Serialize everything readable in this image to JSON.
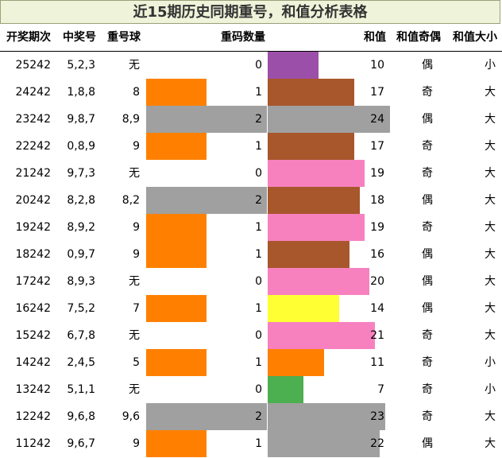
{
  "title": "近15期历史同期重号，和值分析表格",
  "headers": {
    "issue": "开奖期次",
    "number": "中奖号",
    "repeat_ball": "重号球",
    "repeat_count": "重码数量",
    "sum": "和值",
    "parity": "和值奇偶",
    "size": "和值大小"
  },
  "rows": [
    {
      "issue": "25242",
      "number": "5,2,3",
      "repeat_ball": "无",
      "repeat_count": 0,
      "sum": 10,
      "parity": "偶",
      "size": "小"
    },
    {
      "issue": "24242",
      "number": "1,8,8",
      "repeat_ball": "8",
      "repeat_count": 1,
      "sum": 17,
      "parity": "奇",
      "size": "大"
    },
    {
      "issue": "23242",
      "number": "9,8,7",
      "repeat_ball": "8,9",
      "repeat_count": 2,
      "sum": 24,
      "parity": "偶",
      "size": "大"
    },
    {
      "issue": "22242",
      "number": "0,8,9",
      "repeat_ball": "9",
      "repeat_count": 1,
      "sum": 17,
      "parity": "奇",
      "size": "大"
    },
    {
      "issue": "21242",
      "number": "9,7,3",
      "repeat_ball": "无",
      "repeat_count": 0,
      "sum": 19,
      "parity": "奇",
      "size": "大"
    },
    {
      "issue": "20242",
      "number": "8,2,8",
      "repeat_ball": "8,2",
      "repeat_count": 2,
      "sum": 18,
      "parity": "偶",
      "size": "大"
    },
    {
      "issue": "19242",
      "number": "8,9,2",
      "repeat_ball": "9",
      "repeat_count": 1,
      "sum": 19,
      "parity": "奇",
      "size": "大"
    },
    {
      "issue": "18242",
      "number": "0,9,7",
      "repeat_ball": "9",
      "repeat_count": 1,
      "sum": 16,
      "parity": "偶",
      "size": "大"
    },
    {
      "issue": "17242",
      "number": "8,9,3",
      "repeat_ball": "无",
      "repeat_count": 0,
      "sum": 20,
      "parity": "偶",
      "size": "大"
    },
    {
      "issue": "16242",
      "number": "7,5,2",
      "repeat_ball": "7",
      "repeat_count": 1,
      "sum": 14,
      "parity": "偶",
      "size": "大"
    },
    {
      "issue": "15242",
      "number": "6,7,8",
      "repeat_ball": "无",
      "repeat_count": 0,
      "sum": 21,
      "parity": "奇",
      "size": "大"
    },
    {
      "issue": "14242",
      "number": "2,4,5",
      "repeat_ball": "5",
      "repeat_count": 1,
      "sum": 11,
      "parity": "奇",
      "size": "小"
    },
    {
      "issue": "13242",
      "number": "5,1,1",
      "repeat_ball": "无",
      "repeat_count": 0,
      "sum": 7,
      "parity": "奇",
      "size": "小"
    },
    {
      "issue": "12242",
      "number": "9,6,8",
      "repeat_ball": "9,6",
      "repeat_count": 2,
      "sum": 23,
      "parity": "奇",
      "size": "大"
    },
    {
      "issue": "11242",
      "number": "9,6,7",
      "repeat_ball": "9",
      "repeat_count": 1,
      "sum": 22,
      "parity": "偶",
      "size": "大"
    }
  ],
  "chart_data": {
    "type": "table",
    "columns": [
      "开奖期次",
      "中奖号",
      "重号球",
      "重码数量",
      "和值",
      "和值奇偶",
      "和值大小"
    ],
    "repeat_count_max": 2,
    "sum_max": 24,
    "colors": {
      "repeat_1": "#ff8000",
      "repeat_2": "#a0a0a0",
      "sum_7": "#4caf50",
      "sum_10": "#9c4fa8",
      "sum_11": "#ff8000",
      "sum_14": "#ffff33",
      "sum_16_18": "#a8562c",
      "sum_19_21": "#f781bf",
      "sum_22_24": "#a0a0a0"
    }
  }
}
